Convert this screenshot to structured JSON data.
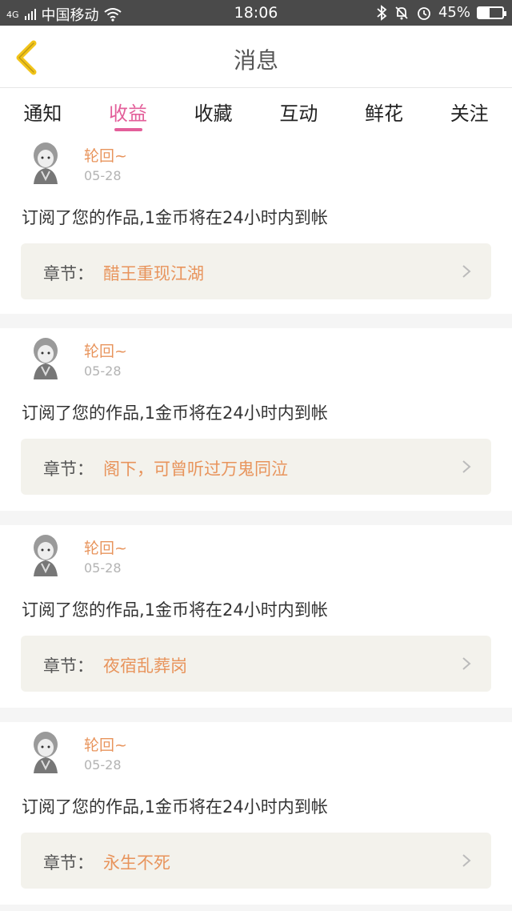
{
  "status_bar": {
    "signal_text": "4G",
    "carrier": "中国移动",
    "time": "18:06",
    "battery": "45%",
    "battery_level": 0.45
  },
  "header": {
    "title": "消息"
  },
  "tabs": [
    {
      "label": "通知",
      "active": false
    },
    {
      "label": "收益",
      "active": true
    },
    {
      "label": "收藏",
      "active": false
    },
    {
      "label": "互动",
      "active": false
    },
    {
      "label": "鲜花",
      "active": false
    },
    {
      "label": "关注",
      "active": false
    }
  ],
  "feed": [
    {
      "username": "轮回~",
      "date": "05-28",
      "message": "订阅了您的作品,1金币将在24小时内到帐",
      "chapter_label": "章节：",
      "chapter_title": "醋王重现江湖"
    },
    {
      "username": "轮回~",
      "date": "05-28",
      "message": "订阅了您的作品,1金币将在24小时内到帐",
      "chapter_label": "章节：",
      "chapter_title": "阁下，可曾听过万鬼同泣"
    },
    {
      "username": "轮回~",
      "date": "05-28",
      "message": "订阅了您的作品,1金币将在24小时内到帐",
      "chapter_label": "章节：",
      "chapter_title": "夜宿乱葬岗"
    },
    {
      "username": "轮回~",
      "date": "05-28",
      "message": "订阅了您的作品,1金币将在24小时内到帐",
      "chapter_label": "章节：",
      "chapter_title": "永生不死"
    }
  ],
  "colors": {
    "accent_tab": "#e35f9a",
    "username": "#e8945c",
    "chapter_title": "#e8945c",
    "back_icon": "#f2c419"
  }
}
